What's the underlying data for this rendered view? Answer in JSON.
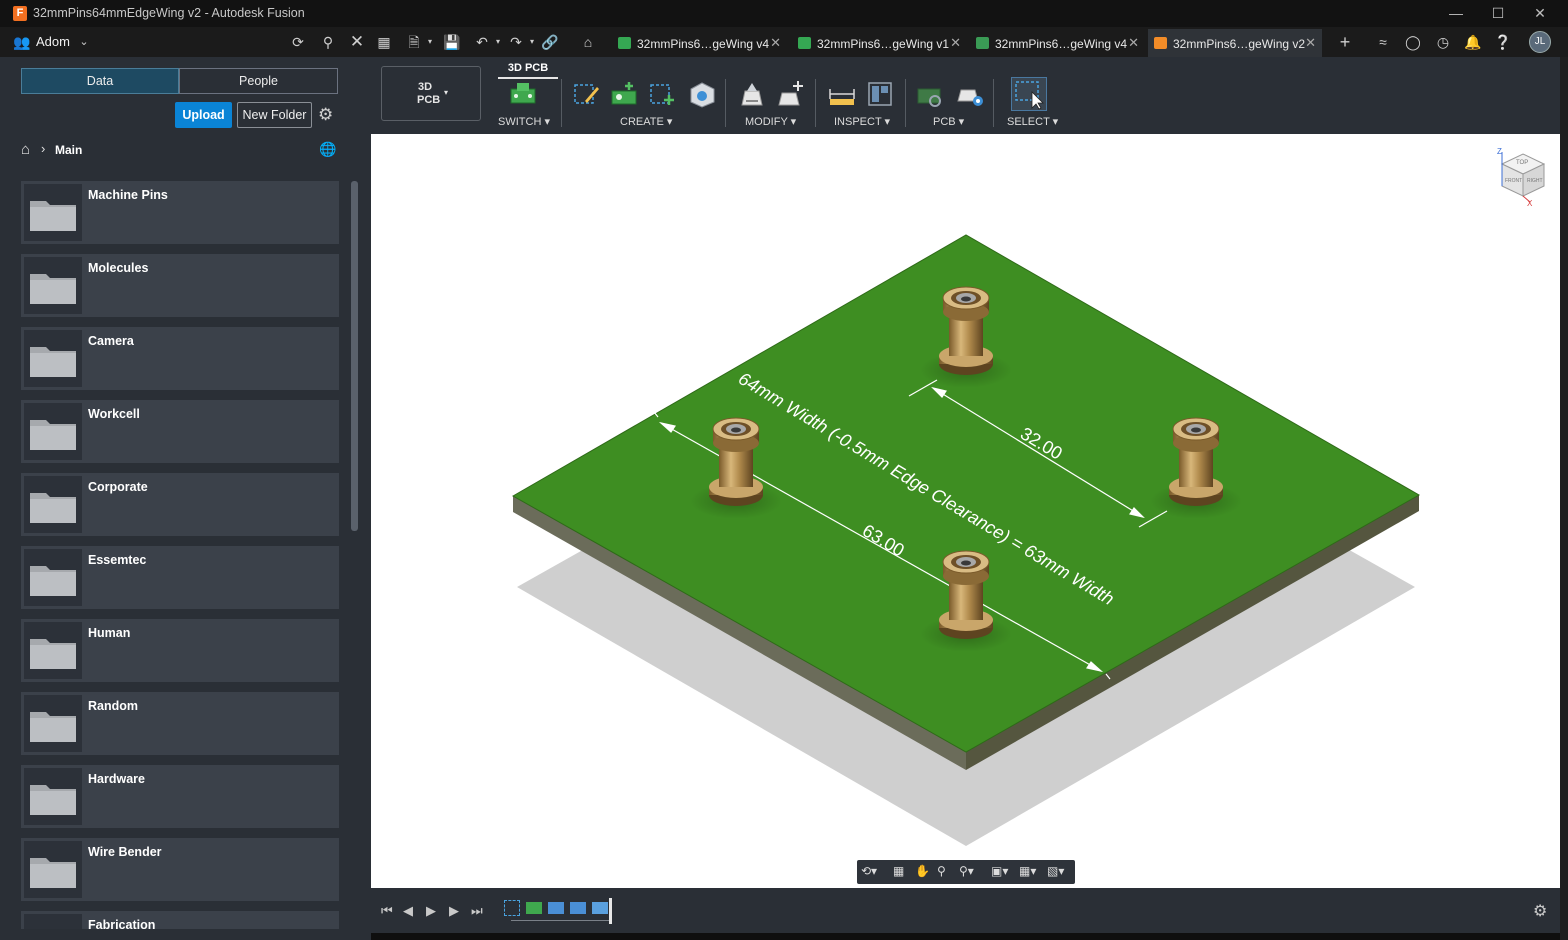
{
  "window": {
    "title": "32mmPins64mmEdgeWing v2 - Autodesk Fusion",
    "app_icon_letter": "F"
  },
  "appbar": {
    "team_name": "Adom",
    "user_initials": "JL",
    "tabs": [
      {
        "label": "32mmPins6…geWing v4",
        "icon_color": "#35a853",
        "active": false
      },
      {
        "label": "32mmPins6…geWing v1",
        "icon_color": "#35a853",
        "active": false
      },
      {
        "label": "32mmPins6…geWing v4",
        "icon_color": "#3a9b55",
        "active": false
      },
      {
        "label": "32mmPins6…geWing v2",
        "icon_color": "#f28c28",
        "active": true
      }
    ]
  },
  "data_panel": {
    "seg_data": "Data",
    "seg_people": "People",
    "upload_label": "Upload",
    "new_folder_label": "New Folder",
    "breadcrumb": "Main",
    "folders": [
      "Machine Pins",
      "Molecules",
      "Camera",
      "Workcell",
      "Corporate",
      "Essemtec",
      "Human",
      "Random",
      "Hardware",
      "Wire Bender",
      "Fabrication"
    ]
  },
  "toolbar": {
    "workspace_line1": "3D",
    "workspace_line2": "PCB",
    "active_tab": "3D PCB",
    "groups": {
      "switch": "SWITCH",
      "create": "CREATE",
      "modify": "MODIFY",
      "inspect": "INSPECT",
      "pcb": "PCB",
      "select": "SELECT"
    }
  },
  "viewport": {
    "dim_width_label": "64mm Width (-0.5mm Edge Clearance) = 63mm Width",
    "dim_63": "63.00",
    "dim_32": "32.00",
    "viewcube_top": "TOP",
    "viewcube_front": "FRONT",
    "viewcube_right": "RIGHT",
    "axis_z": "Z",
    "axis_x": "X"
  },
  "colors": {
    "board_green": "#3e8e22",
    "pin_brass": "#b08a4c",
    "accent_blue": "#0a84d6"
  }
}
